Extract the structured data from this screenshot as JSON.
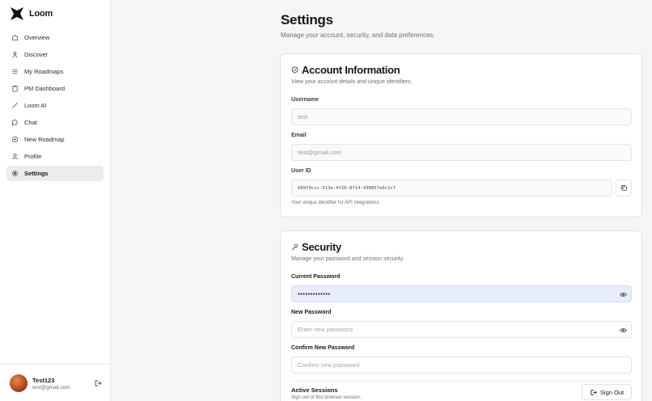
{
  "app": {
    "name": "Loom"
  },
  "sidebar": {
    "items": [
      {
        "label": "Overview",
        "icon": "home-icon"
      },
      {
        "label": "Discover",
        "icon": "compass-icon"
      },
      {
        "label": "My Roadmaps",
        "icon": "list-icon"
      },
      {
        "label": "PM Dashboard",
        "icon": "clipboard-icon"
      },
      {
        "label": "Loom AI",
        "icon": "wand-icon"
      },
      {
        "label": "Chat",
        "icon": "chat-icon"
      },
      {
        "label": "New Roadmap",
        "icon": "plus-circle-icon"
      },
      {
        "label": "Profile",
        "icon": "user-icon"
      },
      {
        "label": "Settings",
        "icon": "gear-icon",
        "active": true
      }
    ],
    "user": {
      "name": "Test123",
      "email": "test@gmail.com"
    }
  },
  "page": {
    "title": "Settings",
    "subtitle": "Manage your account, security, and data preferences."
  },
  "account": {
    "title": "Account Information",
    "description": "View your account details and unique identifiers.",
    "username_label": "Username",
    "username_value": "test",
    "email_label": "Email",
    "email_value": "test@gmail.com",
    "userid_label": "User ID",
    "userid_value": "689f0ccc-513e-4f26-8f14-430057e6c1cf",
    "userid_helper": "Your unique identifier for API integrations."
  },
  "security": {
    "title": "Security",
    "description": "Manage your password and session security.",
    "current_password_label": "Current Password",
    "current_password_value": "•••••••••••••",
    "new_password_label": "New Password",
    "new_password_placeholder": "Enter new password",
    "confirm_password_label": "Confirm New Password",
    "confirm_password_placeholder": "Confirm new password",
    "sessions_title": "Active Sessions",
    "sessions_description": "Sign out of this browser session.",
    "sign_out_label": "Sign Out"
  },
  "colors": {
    "accent_fill": "#e8edfb",
    "active_nav": "#ececef"
  }
}
